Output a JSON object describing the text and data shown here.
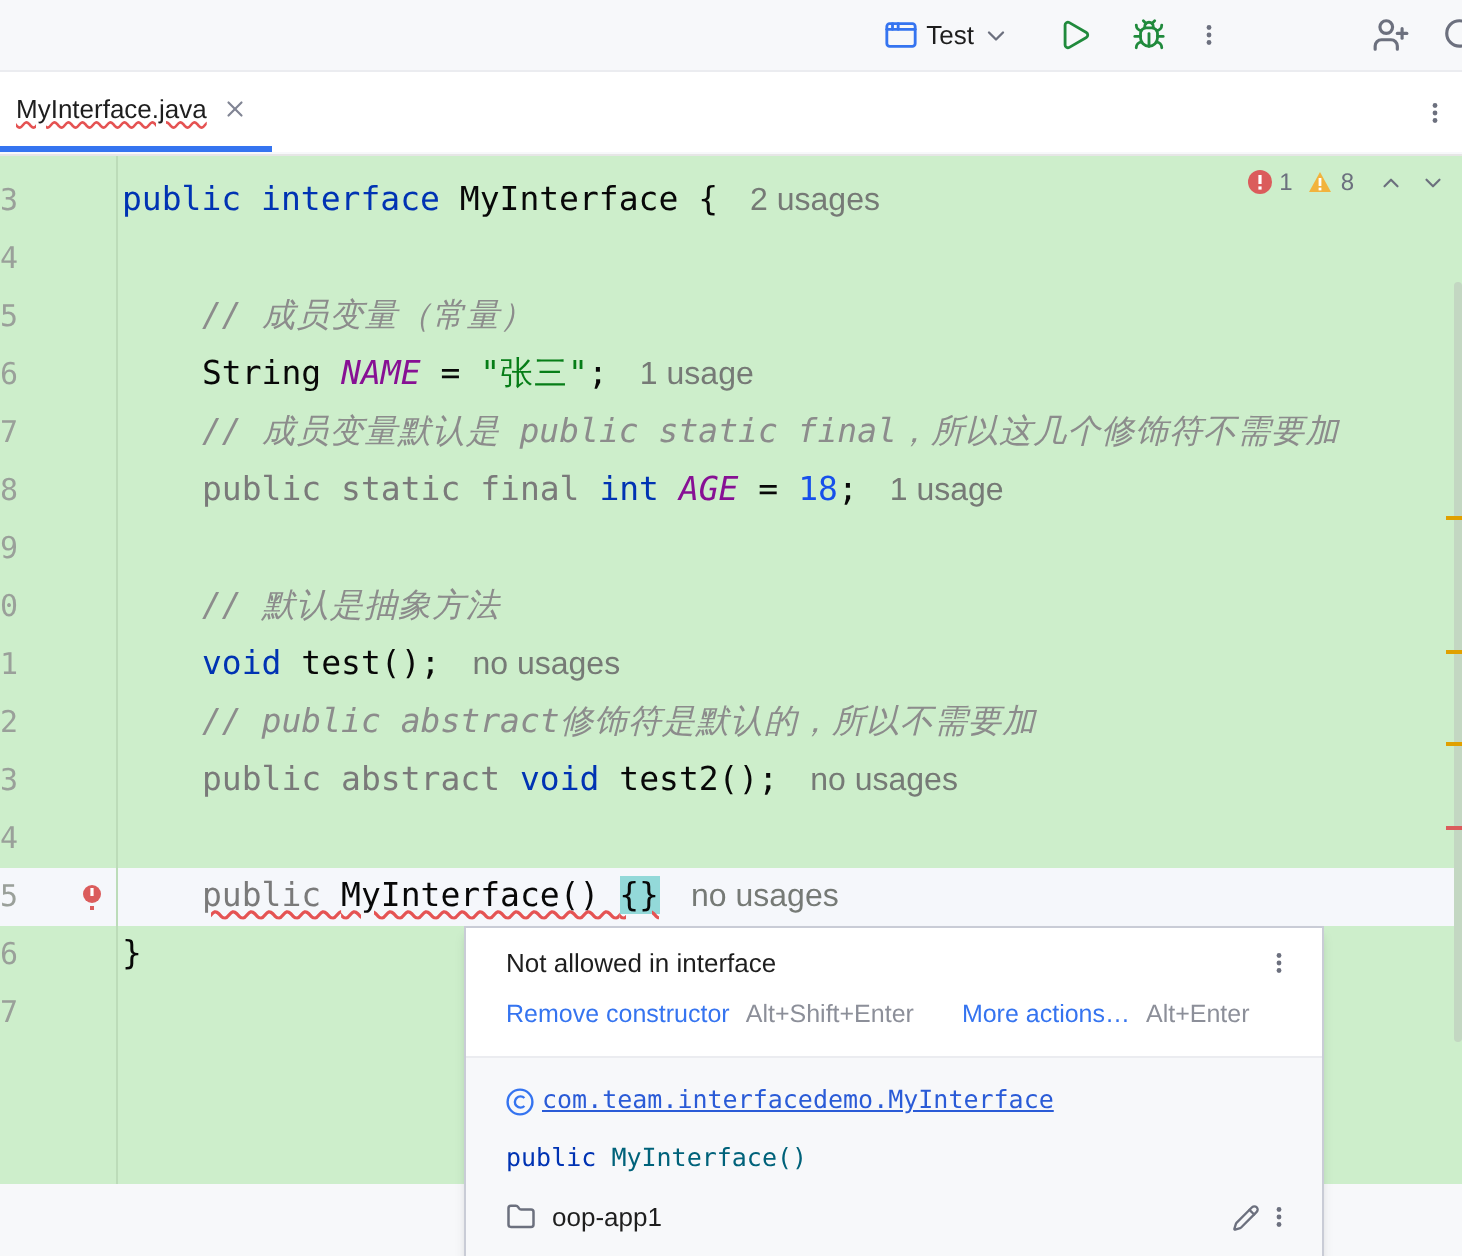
{
  "toolbar": {
    "run_config": "Test"
  },
  "tabs": [
    {
      "label": "MyInterface.java",
      "selected": true,
      "error": true
    }
  ],
  "inspections": {
    "errors": "1",
    "warnings": "8"
  },
  "lines": [
    {
      "number": "3",
      "tokens": [
        {
          "text": "public interface ",
          "kind": "keyword"
        },
        {
          "text": "MyInterface {",
          "kind": "plain"
        }
      ],
      "hint": "2 usages"
    },
    {
      "number": "4"
    },
    {
      "number": "5",
      "indent": true,
      "tokens": [
        {
          "text": "// 成员变量（常量）",
          "kind": "comment"
        }
      ]
    },
    {
      "number": "6",
      "indent": true,
      "tokens": [
        {
          "text": "String ",
          "kind": "plain"
        },
        {
          "text": "NAME",
          "kind": "constant"
        },
        {
          "text": " = ",
          "kind": "plain"
        },
        {
          "text": "\"张三\"",
          "kind": "string"
        },
        {
          "text": ";",
          "kind": "plain"
        }
      ],
      "hint": "1 usage"
    },
    {
      "number": "7",
      "indent": true,
      "tokens": [
        {
          "text": "// 成员变量默认是 public static final，所以这几个修饰符不需要加",
          "kind": "comment"
        }
      ]
    },
    {
      "number": "8",
      "indent": true,
      "tokens": [
        {
          "text": "public static final ",
          "kind": "unused"
        },
        {
          "text": "int ",
          "kind": "keyword"
        },
        {
          "text": "AGE",
          "kind": "constant"
        },
        {
          "text": " = ",
          "kind": "plain"
        },
        {
          "text": "18",
          "kind": "number"
        },
        {
          "text": ";",
          "kind": "plain"
        }
      ],
      "hint": "1 usage"
    },
    {
      "number": "9"
    },
    {
      "number": "0",
      "indent": true,
      "tokens": [
        {
          "text": "// 默认是抽象方法",
          "kind": "comment"
        }
      ]
    },
    {
      "number": "1",
      "indent": true,
      "tokens": [
        {
          "text": "void",
          "kind": "keyword"
        },
        {
          "text": " test();",
          "kind": "plain"
        }
      ],
      "hint": "no usages"
    },
    {
      "number": "2",
      "indent": true,
      "tokens": [
        {
          "text": "// public abstract修饰符是默认的，所以不需要加",
          "kind": "comment"
        }
      ]
    },
    {
      "number": "3",
      "indent": true,
      "tokens": [
        {
          "text": "public abstract ",
          "kind": "unused"
        },
        {
          "text": "void",
          "kind": "keyword"
        },
        {
          "text": " test2();",
          "kind": "plain"
        }
      ],
      "hint": "no usages"
    },
    {
      "number": "4"
    },
    {
      "number": "5",
      "current": true,
      "error": true,
      "indent": true,
      "tokens": [
        {
          "text": "public ",
          "kind": "unused"
        },
        {
          "text": "MyInterface() ",
          "kind": "plain"
        },
        {
          "text": "{}",
          "kind": "brace"
        }
      ],
      "hint": "no usages"
    },
    {
      "number": "6",
      "tokens": [
        {
          "text": "}",
          "kind": "plain"
        }
      ]
    },
    {
      "number": "7"
    }
  ],
  "popup": {
    "title": "Not allowed in interface",
    "actions": [
      {
        "label": "Remove constructor",
        "shortcut": "Alt+Shift+Enter"
      },
      {
        "label": "More actions…",
        "shortcut": "Alt+Enter"
      }
    ],
    "class_link": "com.team.interfacedemo.MyInterface",
    "signature": [
      {
        "text": "public ",
        "kind": "keyword"
      },
      {
        "text": "MyInterface()",
        "kind": "method"
      }
    ],
    "module": "oop-app1"
  }
}
